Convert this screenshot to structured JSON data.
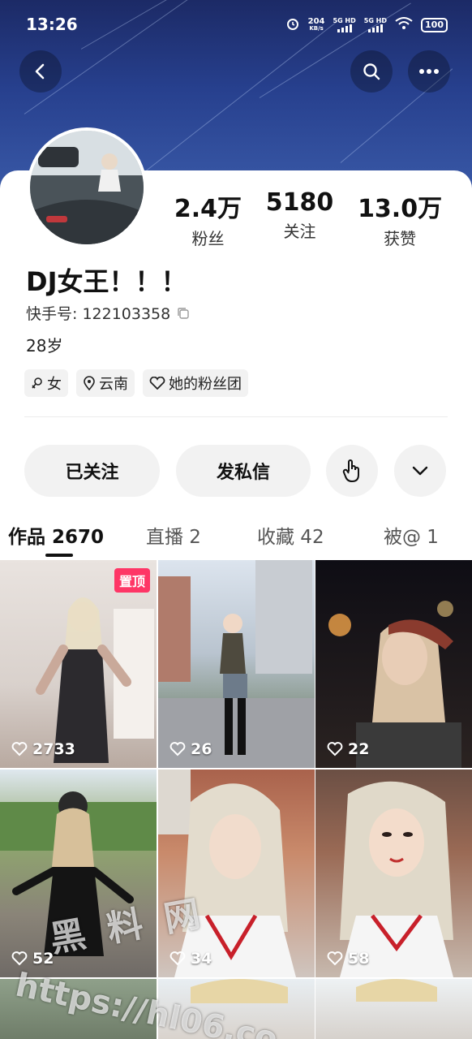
{
  "status": {
    "time": "13:26",
    "net_speed": "204",
    "net_unit": "KB/s",
    "sim1": "5G HD",
    "sim2": "5G HD",
    "battery": "100"
  },
  "profile": {
    "stats": [
      {
        "value": "2.4万",
        "label": "粉丝"
      },
      {
        "value": "5180",
        "label": "关注"
      },
      {
        "value": "13.0万",
        "label": "获赞"
      }
    ],
    "name": "DJ女王！！！",
    "uid_label": "快手号: 122103358",
    "age": "28岁",
    "tags": [
      {
        "icon": "female-icon",
        "label": "女"
      },
      {
        "icon": "location-icon",
        "label": "云南"
      },
      {
        "icon": "fan-group-icon",
        "label": "她的粉丝团"
      }
    ]
  },
  "actions": {
    "follow": "已关注",
    "message": "发私信"
  },
  "tabs": [
    {
      "label": "作品 2670",
      "active": true
    },
    {
      "label": "直播 2",
      "active": false
    },
    {
      "label": "收藏 42",
      "active": false
    },
    {
      "label": "被@ 1",
      "active": false
    }
  ],
  "videos": [
    {
      "likes": "2733",
      "pinned": "置顶"
    },
    {
      "likes": "26"
    },
    {
      "likes": "22"
    },
    {
      "likes": "52"
    },
    {
      "likes": "34"
    },
    {
      "likes": "58"
    }
  ],
  "watermark": {
    "chars": "黑 料 网",
    "url": "https://hl06.co"
  }
}
